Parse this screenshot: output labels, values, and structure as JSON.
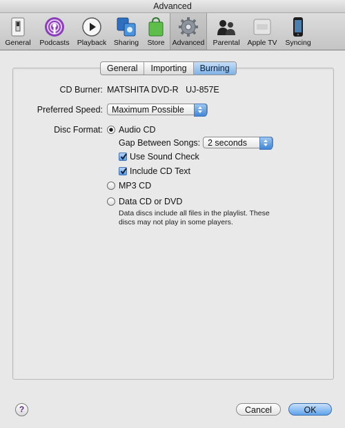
{
  "window": {
    "title": "Advanced"
  },
  "toolbar": {
    "items": [
      {
        "label": "General",
        "icon": "general-switch-icon"
      },
      {
        "label": "Podcasts",
        "icon": "podcasts-icon"
      },
      {
        "label": "Playback",
        "icon": "playback-icon"
      },
      {
        "label": "Sharing",
        "icon": "sharing-icon"
      },
      {
        "label": "Store",
        "icon": "store-bag-icon"
      },
      {
        "label": "Advanced",
        "icon": "gear-icon",
        "selected": true
      },
      {
        "label": "Parental",
        "icon": "parental-icon"
      },
      {
        "label": "Apple TV",
        "icon": "apple-tv-icon"
      },
      {
        "label": "Syncing",
        "icon": "iphone-icon"
      }
    ]
  },
  "tabs": [
    {
      "label": "General"
    },
    {
      "label": "Importing"
    },
    {
      "label": "Burning",
      "active": true
    }
  ],
  "burning": {
    "cd_burner_label": "CD Burner:",
    "cd_burner_value": "MATSHITA DVD-R   UJ-857E",
    "preferred_speed_label": "Preferred Speed:",
    "preferred_speed_value": "Maximum Possible",
    "disc_format_label": "Disc Format:",
    "audio_cd_label": "Audio CD",
    "gap_label": "Gap Between Songs:",
    "gap_value": "2 seconds",
    "use_sound_check_label": "Use Sound Check",
    "include_cd_text_label": "Include CD Text",
    "mp3_cd_label": "MP3 CD",
    "data_cd_label": "Data CD or DVD",
    "data_note_line1": "Data discs include all files in the playlist. These",
    "data_note_line2": "discs may not play in some players."
  },
  "footer": {
    "help_label": "?",
    "cancel_label": "Cancel",
    "ok_label": "OK"
  },
  "colors": {
    "accent_blue": "#5fa2ea",
    "panel_bg": "#e9e9e9"
  }
}
